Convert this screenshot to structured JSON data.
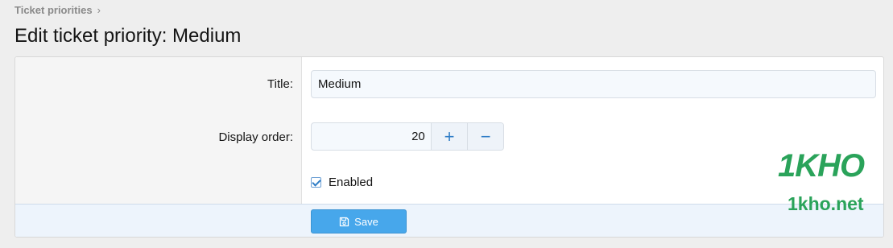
{
  "breadcrumb": {
    "items": [
      "Ticket priorities"
    ],
    "separator": "›"
  },
  "page": {
    "title": "Edit ticket priority: Medium"
  },
  "form": {
    "title_label": "Title:",
    "title_value": "Medium",
    "display_order_label": "Display order:",
    "display_order_value": "20",
    "increment_symbol": "+",
    "decrement_symbol": "−",
    "enabled_label": "Enabled",
    "enabled_checked": true,
    "save_label": "Save",
    "save_icon": "floppy-disk-icon"
  },
  "watermark": {
    "logo": "1KHO",
    "url": "1kho.net"
  },
  "colors": {
    "accent": "#47a7eb",
    "stepper_icon": "#2f7dc6",
    "watermark": "#2aa35a"
  }
}
